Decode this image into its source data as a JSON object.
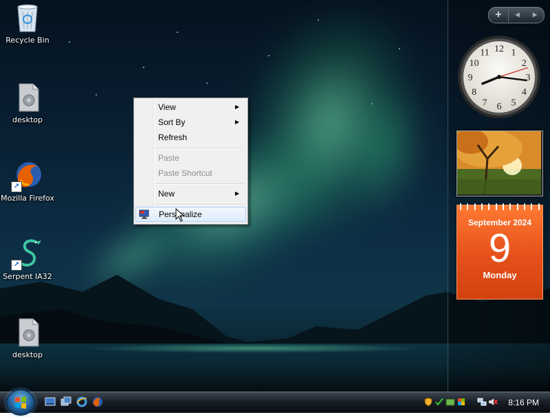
{
  "desktop_icons": [
    {
      "label": "Recycle Bin",
      "icon": "recycle-bin-icon"
    },
    {
      "label": "desktop",
      "icon": "file-icon"
    },
    {
      "label": "Mozilla Firefox",
      "icon": "firefox-icon"
    },
    {
      "label": "Serpent IA32",
      "icon": "serpent-icon"
    },
    {
      "label": "desktop",
      "icon": "file-icon"
    }
  ],
  "context_menu": {
    "items": [
      {
        "label": "View",
        "submenu": true,
        "enabled": true
      },
      {
        "label": "Sort By",
        "submenu": true,
        "enabled": true
      },
      {
        "label": "Refresh",
        "submenu": false,
        "enabled": true
      },
      {
        "label": "Paste",
        "submenu": false,
        "enabled": false
      },
      {
        "label": "Paste Shortcut",
        "submenu": false,
        "enabled": false
      },
      {
        "label": "New",
        "submenu": true,
        "enabled": true
      },
      {
        "label": "Personalize",
        "submenu": false,
        "enabled": true,
        "highlighted": true,
        "icon": "display-icon"
      }
    ]
  },
  "sidebar": {
    "controls": {
      "add": "+",
      "prev": "◀",
      "next": "▶"
    },
    "clock": {
      "hour": 8,
      "minute": 16,
      "second": 12,
      "numerals": [
        "12",
        "1",
        "2",
        "3",
        "4",
        "5",
        "6",
        "7",
        "8",
        "9",
        "10",
        "11"
      ]
    },
    "calendar": {
      "month": "September 2024",
      "day": "9",
      "weekday": "Monday"
    }
  },
  "taskbar": {
    "quick_launch": [
      "show-desktop-icon",
      "switch-windows-icon",
      "internet-explorer-icon",
      "firefox-icon"
    ],
    "tray_icons": [
      "windows-defender-icon",
      "security-center-icon",
      "network-icon",
      "volume-muted-icon"
    ],
    "clock": "8:16 PM"
  },
  "colors": {
    "taskbar": "#1a2028",
    "calendar": "#e5501a",
    "menu_highlight": "#e0ecfb",
    "aurora": "#82ffbe"
  }
}
